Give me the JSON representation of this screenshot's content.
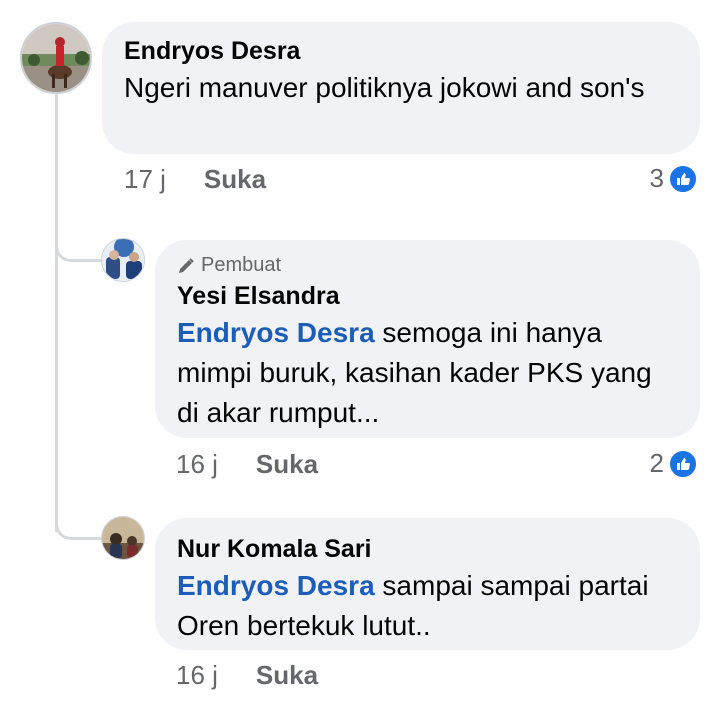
{
  "comments": [
    {
      "author": "Endryos Desra",
      "text": "Ngeri manuver politiknya jokowi and son's",
      "time": "17 j",
      "like_label": "Suka",
      "reaction_count": "3"
    }
  ],
  "replies": [
    {
      "badge": "Pembuat",
      "author": "Yesi Elsandra",
      "mention": "Endryos Desra",
      "text": " semoga ini hanya mimpi buruk, kasihan kader PKS yang di akar rumput...",
      "time": "16 j",
      "like_label": "Suka",
      "reaction_count": "2"
    },
    {
      "author": "Nur Komala Sari",
      "mention": "Endryos Desra",
      "text": " sampai sampai partai Oren bertekuk lutut..",
      "time": "16 j",
      "like_label": "Suka"
    }
  ],
  "icons": {
    "like_reaction": "thumbs-up-icon",
    "author_badge": "pencil-icon"
  },
  "colors": {
    "bubble_bg": "#f0f2f5",
    "mention": "#1b5db8",
    "like_badge": "#1b74e4",
    "meta_text": "#65676b"
  }
}
